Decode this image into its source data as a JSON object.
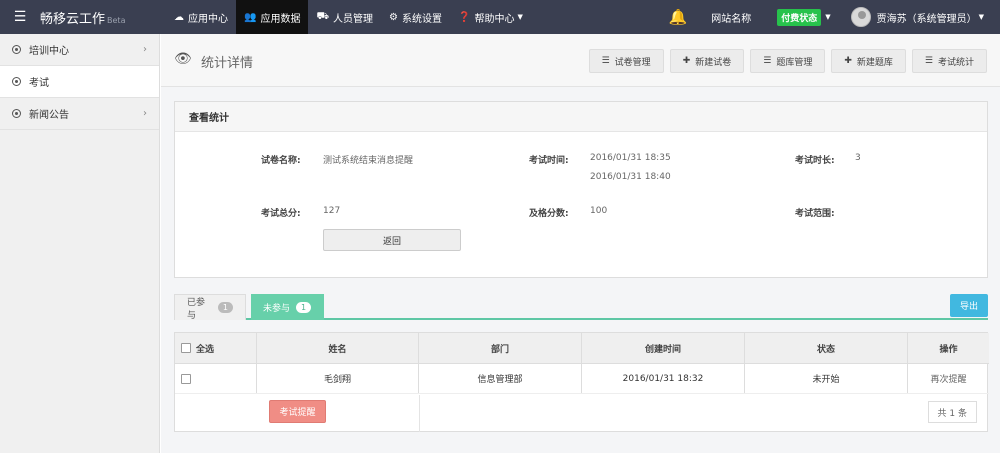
{
  "topbar": {
    "brand_title": "畅移云工作",
    "brand_suffix": "Beta",
    "nav": [
      {
        "label": "应用中心",
        "icon": "cloud-icon"
      },
      {
        "label": "应用数据",
        "icon": "users-icon",
        "active": true
      },
      {
        "label": "人员管理",
        "icon": "car-icon"
      },
      {
        "label": "系统设置",
        "icon": "gears-icon"
      },
      {
        "label": "帮助中心",
        "icon": "question-icon"
      }
    ],
    "site_name": "网站名称",
    "status_badge": "付费状态",
    "user_name": "贾海苏（系统管理员）"
  },
  "sidebar": {
    "items": [
      {
        "label": "培训中心",
        "has_children": true
      },
      {
        "label": "考试",
        "active": true
      },
      {
        "label": "新闻公告",
        "has_children": true
      }
    ]
  },
  "page": {
    "title": "统计详情",
    "toolbar": [
      {
        "label": "试卷管理",
        "icon": "list-icon"
      },
      {
        "label": "新建试卷",
        "icon": "plus-icon"
      },
      {
        "label": "题库管理",
        "icon": "list-icon"
      },
      {
        "label": "新建题库",
        "icon": "plus-icon"
      },
      {
        "label": "考试统计",
        "icon": "list-icon"
      }
    ]
  },
  "stats": {
    "heading": "查看统计",
    "paper_name_label": "试卷名称:",
    "paper_name": "测试系统结束消息提醒",
    "exam_time_label": "考试时间:",
    "exam_time_start": "2016/01/31 18:35",
    "exam_time_end": "2016/01/31 18:40",
    "duration_label": "考试时长:",
    "duration": "3",
    "total_label": "考试总分:",
    "total": "127",
    "pass_label": "及格分数:",
    "pass": "100",
    "scope_label": "考试范围:",
    "scope": "",
    "back_label": "返回"
  },
  "tabs": [
    {
      "label": "已参与",
      "count": "1"
    },
    {
      "label": "未参与",
      "count": "1",
      "active": true
    }
  ],
  "export_label": "导出",
  "table": {
    "select_all": "全选",
    "columns": [
      "姓名",
      "部门",
      "创建时间",
      "状态",
      "操作"
    ],
    "rows": [
      {
        "name": "毛剑翔",
        "dept": "信息管理部",
        "created": "2016/01/31 18:32",
        "status": "未开始",
        "action": "再次提醒"
      }
    ],
    "remind_label": "考试提醒",
    "pager": "共 1 条"
  }
}
